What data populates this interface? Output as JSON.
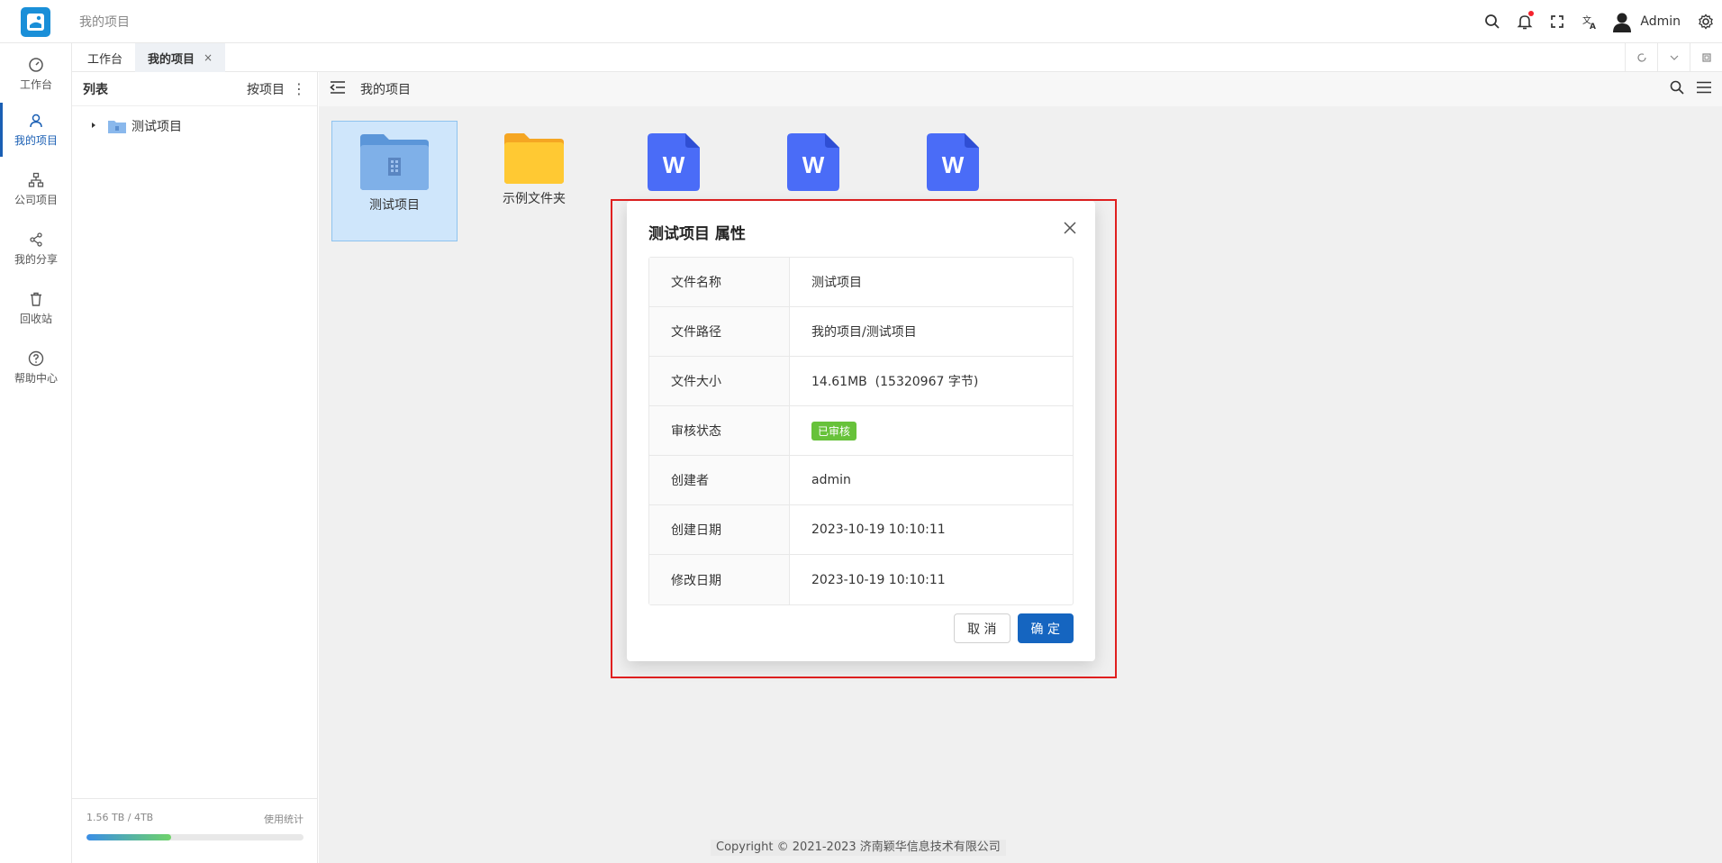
{
  "header": {
    "breadcrumb": "我的项目",
    "user_name": "Admin",
    "icons": [
      "search-icon",
      "bell-icon",
      "fullscreen-icon",
      "translate-icon",
      "user-avatar-icon",
      "gear-icon"
    ],
    "notification_dot_color": "#f5222d"
  },
  "sidebar": {
    "items": [
      {
        "label": "工作台",
        "icon": "dashboard-icon"
      },
      {
        "label": "我的项目",
        "icon": "user-icon",
        "active": true
      },
      {
        "label": "公司项目",
        "icon": "org-icon"
      },
      {
        "label": "我的分享",
        "icon": "share-icon"
      },
      {
        "label": "回收站",
        "icon": "trash-icon"
      },
      {
        "label": "帮助中心",
        "icon": "help-icon"
      }
    ],
    "active_color": "#1a5fb4"
  },
  "tabs": {
    "items": [
      {
        "label": "工作台"
      },
      {
        "label": "我的项目",
        "close": "×",
        "active": true
      }
    ]
  },
  "tree": {
    "title": "列表",
    "sort_label": "按项目",
    "more": "⋮",
    "nodes": [
      {
        "label": "测试项目"
      }
    ],
    "storage": {
      "usage": "1.56 TB / 4TB",
      "stats_link": "使用统计",
      "fraction_shown": 0.39
    }
  },
  "main": {
    "path": "我的项目",
    "files": [
      {
        "name": "测试项目",
        "type": "project-folder",
        "selected": true
      },
      {
        "name": "示例文件夹",
        "type": "folder"
      },
      {
        "name": "",
        "type": "word-doc",
        "glyph": "W"
      },
      {
        "name": "",
        "type": "word-doc",
        "glyph": "W"
      },
      {
        "name": "",
        "type": "word-doc",
        "glyph": "W"
      }
    ],
    "copyright": "Copyright © 2021-2023 济南颖华信息技术有限公司"
  },
  "dialog": {
    "title": "测试项目 属性",
    "close": "×",
    "rows": [
      {
        "key": "文件名称",
        "value": "测试项目"
      },
      {
        "key": "文件路径",
        "value": "我的项目/测试项目"
      },
      {
        "key": "文件大小",
        "value": "14.61MB  (15320967 字节)"
      },
      {
        "key": "审核状态",
        "value": "已审核",
        "badge": true
      },
      {
        "key": "创建者",
        "value": "admin"
      },
      {
        "key": "创建日期",
        "value": "2023-10-19 10:10:11"
      },
      {
        "key": "修改日期",
        "value": "2023-10-19 10:10:11"
      }
    ],
    "cancel_label": "取 消",
    "ok_label": "确 定",
    "ok_color": "#1565c0",
    "badge_color": "#67c23a",
    "highlight_color": "#e02020"
  }
}
